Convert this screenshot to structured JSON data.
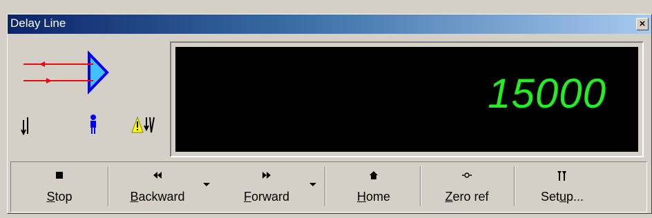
{
  "window": {
    "title": "Delay Line",
    "close_glyph": "×"
  },
  "display": {
    "value": "15000",
    "color": "#22ee22"
  },
  "status_icons": [
    "beam-path-icon",
    "limit-switch-icon",
    "person-icon",
    "warning-icon",
    "sensor-icon"
  ],
  "toolbar": {
    "stop": {
      "mnemonic": "S",
      "rest": "top"
    },
    "backward": {
      "mnemonic": "B",
      "rest": "ackward"
    },
    "forward": {
      "mnemonic": "F",
      "rest": "orward"
    },
    "home": {
      "mnemonic": "H",
      "rest": "ome"
    },
    "zero_ref": {
      "mnemonic": "Z",
      "rest": "ero ref"
    },
    "setup": {
      "before": "Set",
      "mnemonic": "u",
      "after": "p..."
    }
  },
  "colors": {
    "title_start": "#0a246a",
    "title_end": "#a6caf0",
    "face": "#d4d0c8"
  }
}
